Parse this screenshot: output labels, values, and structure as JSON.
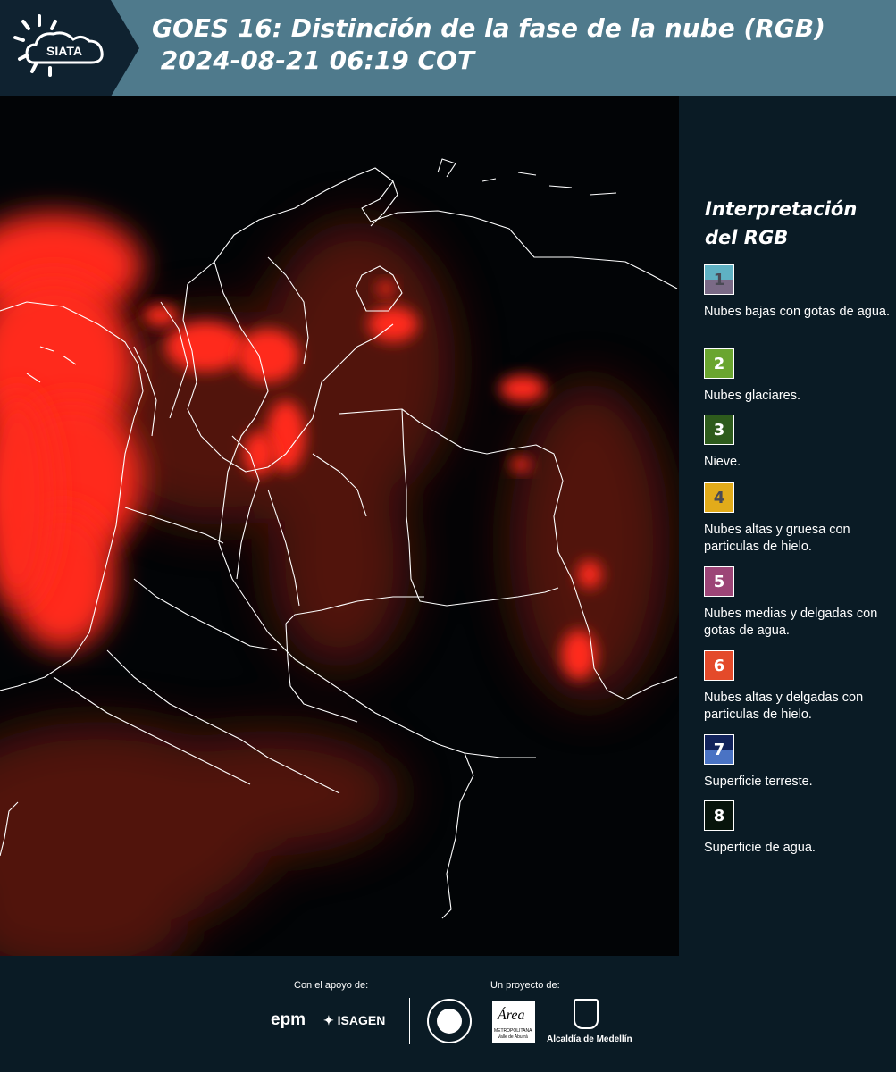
{
  "header": {
    "title_line1": "GOES 16: Distinción de la fase de la nube (RGB)",
    "title_line2": " 2024-08-21 06:19 COT",
    "logo_text": "SIATA",
    "band_color": "#4f7a8c",
    "logo_band_color": "#0f2230"
  },
  "legend": {
    "title": "Interpretación del RGB",
    "items": [
      {
        "number": "1",
        "label": "Nubes bajas con gotas de agua.",
        "color_top": "#5fb1c3",
        "color_bottom": "#7a6a86",
        "text_color": "#4a4a55"
      },
      {
        "number": "2",
        "label": "Nubes glaciares.",
        "color_top": "#6aa52f",
        "color_bottom": "#6aa52f",
        "text_color": "#ffffff"
      },
      {
        "number": "3",
        "label": "Nieve.",
        "color_top": "#2e5b1c",
        "color_bottom": "#2e5b1c",
        "text_color": "#ffffff"
      },
      {
        "number": "4",
        "label": "Nubes altas y gruesa con particulas de hielo.",
        "color_top": "#e2ab1a",
        "color_bottom": "#e2ab1a",
        "text_color": "#4a4a55"
      },
      {
        "number": "5",
        "label": "Nubes medias y delgadas con gotas de agua.",
        "color_top": "#9c4577",
        "color_bottom": "#9c4577",
        "text_color": "#ffffff"
      },
      {
        "number": "6",
        "label": "Nubes altas y delgadas con particulas de hielo.",
        "color_top": "#e44a2a",
        "color_bottom": "#e44a2a",
        "text_color": "#ffffff"
      },
      {
        "number": "7",
        "label": "Superficie terreste.",
        "color_top": "#12235c",
        "color_bottom": "#4a73c4",
        "text_color": "#ffffff"
      },
      {
        "number": "8",
        "label": "Superficie de agua.",
        "color_top": "#07140b",
        "color_bottom": "#07140b",
        "text_color": "#ffffff"
      }
    ]
  },
  "footer": {
    "support_label": "Con el apoyo de:",
    "project_label": "Un proyecto de:",
    "logos": [
      "epm",
      "ISAGEN",
      "Área Metropolitana Valle de Aburrá",
      "Alcaldía de Medellín"
    ],
    "epm_text": "epm",
    "isagen_text": "ISAGEN",
    "area_text": "Área",
    "area_subtitle": "METROPOLITANA",
    "area_subtitle2": "Valle de Aburrá",
    "alcaldia_text": "Alcaldía de Medellín"
  },
  "map": {
    "cloud_color": "#ff2a1e",
    "boundary_color": "#ffffff",
    "background_color": "#020406"
  }
}
